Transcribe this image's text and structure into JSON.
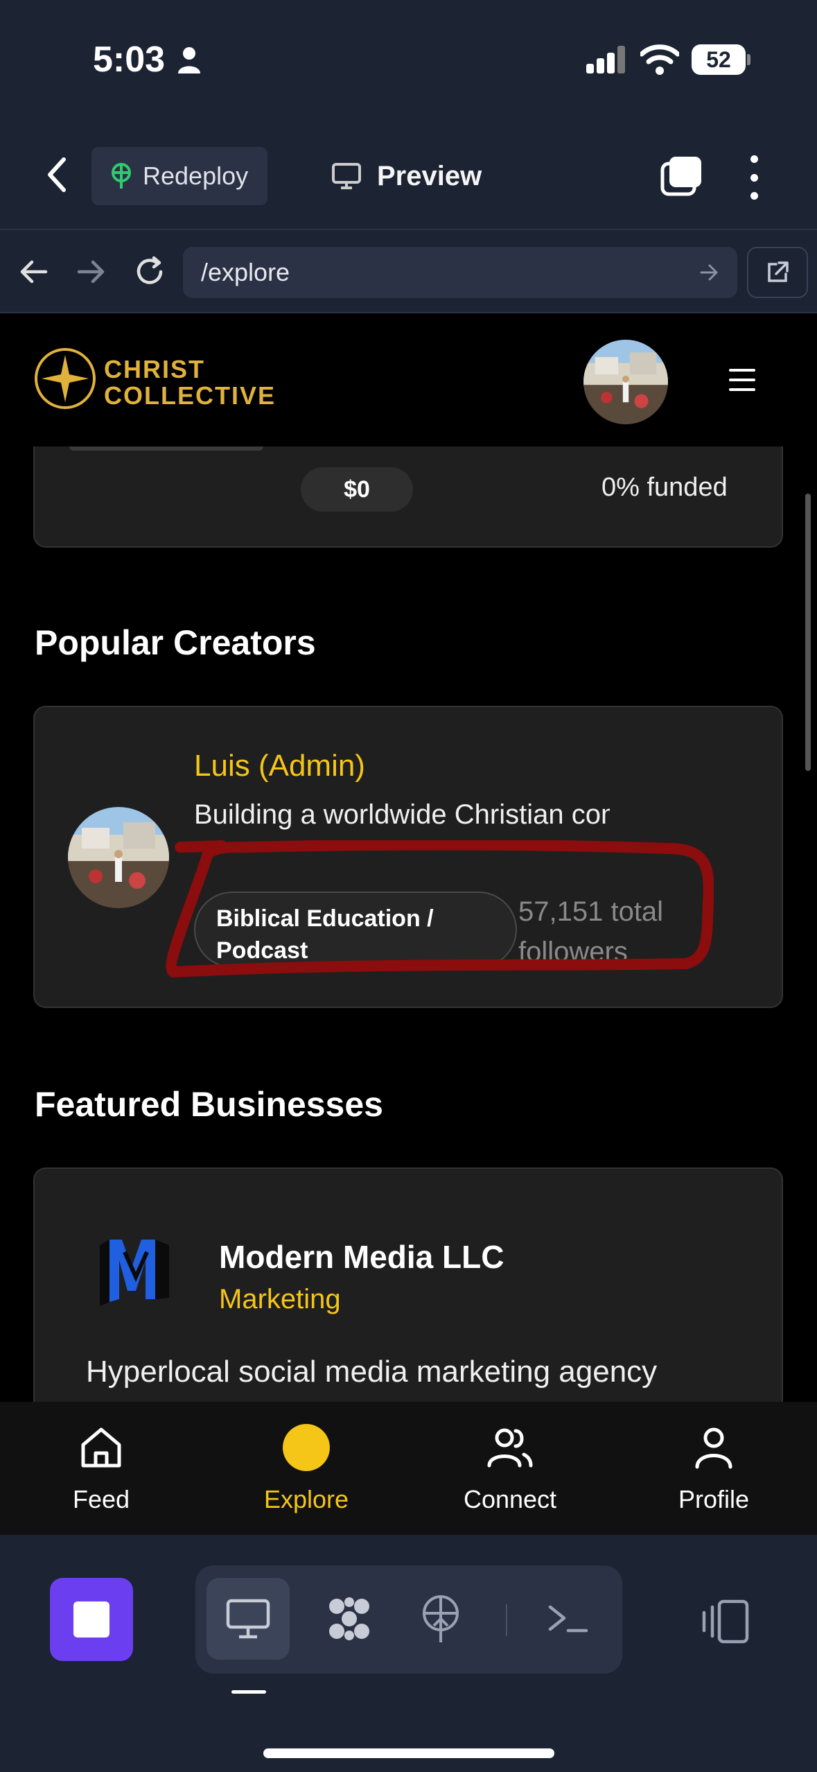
{
  "status_bar": {
    "time": "5:03",
    "battery": "52"
  },
  "replit_header": {
    "redeploy_label": "Redeploy",
    "preview_label": "Preview"
  },
  "browser_bar": {
    "url": "/explore"
  },
  "site": {
    "brand": {
      "line1": "CHRIST",
      "line2": "COLLECTIVE"
    },
    "funding": {
      "amount": "$0",
      "funded": "0% funded"
    },
    "popular_creators": {
      "title": "Popular Creators",
      "creator": {
        "name": "Luis (Admin)",
        "bio": "Building a worldwide Christian community through digital min",
        "tag_line1": "Biblical Education /",
        "tag_line2": "Podcast",
        "followers_line1": "57,151 total",
        "followers_line2": "followers"
      }
    },
    "featured_businesses": {
      "title": "Featured Businesses",
      "business": {
        "name": "Modern Media LLC",
        "category": "Marketing",
        "description": "Hyperlocal social media marketing agency"
      }
    }
  },
  "tab_bar": [
    {
      "label": "Feed",
      "icon": "home-icon"
    },
    {
      "label": "Explore",
      "icon": "explore-dot-icon",
      "active": true
    },
    {
      "label": "Connect",
      "icon": "users-icon"
    },
    {
      "label": "Profile",
      "icon": "user-icon"
    }
  ],
  "colors": {
    "accent_gold": "#f5c518",
    "replit_bg": "#1c2333",
    "stop_purple": "#6b3ff0",
    "annotation_red": "#8b0d0d"
  }
}
